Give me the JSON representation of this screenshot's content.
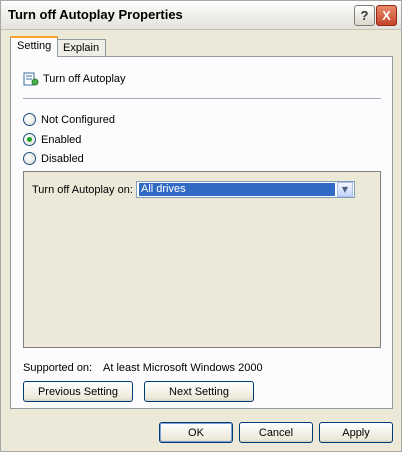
{
  "window": {
    "title": "Turn off Autoplay Properties"
  },
  "title_buttons": {
    "help": "?",
    "close": "X"
  },
  "tabs": [
    {
      "label": "Setting"
    },
    {
      "label": "Explain"
    }
  ],
  "policy": {
    "name": "Turn off Autoplay"
  },
  "state": {
    "options": [
      {
        "label": "Not Configured",
        "selected": false
      },
      {
        "label": "Enabled",
        "selected": true
      },
      {
        "label": "Disabled",
        "selected": false
      }
    ]
  },
  "setting": {
    "label": "Turn off Autoplay on:",
    "value": "All drives"
  },
  "supported": {
    "label": "Supported on:",
    "value": "At least Microsoft Windows 2000"
  },
  "nav": {
    "previous": "Previous Setting",
    "next": "Next Setting"
  },
  "dialog_buttons": {
    "ok": "OK",
    "cancel": "Cancel",
    "apply": "Apply"
  }
}
